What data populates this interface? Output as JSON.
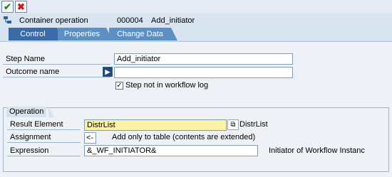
{
  "toolbar": {
    "ok_icon": "check-icon",
    "cancel_icon": "close-icon"
  },
  "header": {
    "icon": "container-operation-icon",
    "title": "Container operation",
    "step_number": "000004",
    "step_name": "Add_initiator"
  },
  "tabs": [
    {
      "label": "Control",
      "active": true
    },
    {
      "label": "Properties",
      "active": false
    },
    {
      "label": "Change Data",
      "active": false
    }
  ],
  "control": {
    "step_name_label": "Step Name",
    "step_name_value": "Add_initiator",
    "outcome_name_label": "Outcome name",
    "outcome_name_value": "",
    "not_in_log_label": "Step not in workflow log",
    "not_in_log_checked": true,
    "not_in_log_mark": "✓"
  },
  "operation": {
    "group_title": "Operation",
    "result_element_label": "Result Element",
    "result_element_value": "DistrList",
    "result_element_desc": "DistrList",
    "assignment_label": "Assignment",
    "assignment_value": "<-",
    "assignment_desc": "Add only to table (contents are extended)",
    "expression_label": "Expression",
    "expression_value": "&_WF_INITIATOR&",
    "expression_desc": "Initiator of Workflow Instanc"
  },
  "colors": {
    "accent": "#3b6aa8",
    "tab_inactive": "#5c8fc4",
    "highlight_field": "#fdf3a7",
    "background": "#d9e4f1"
  }
}
